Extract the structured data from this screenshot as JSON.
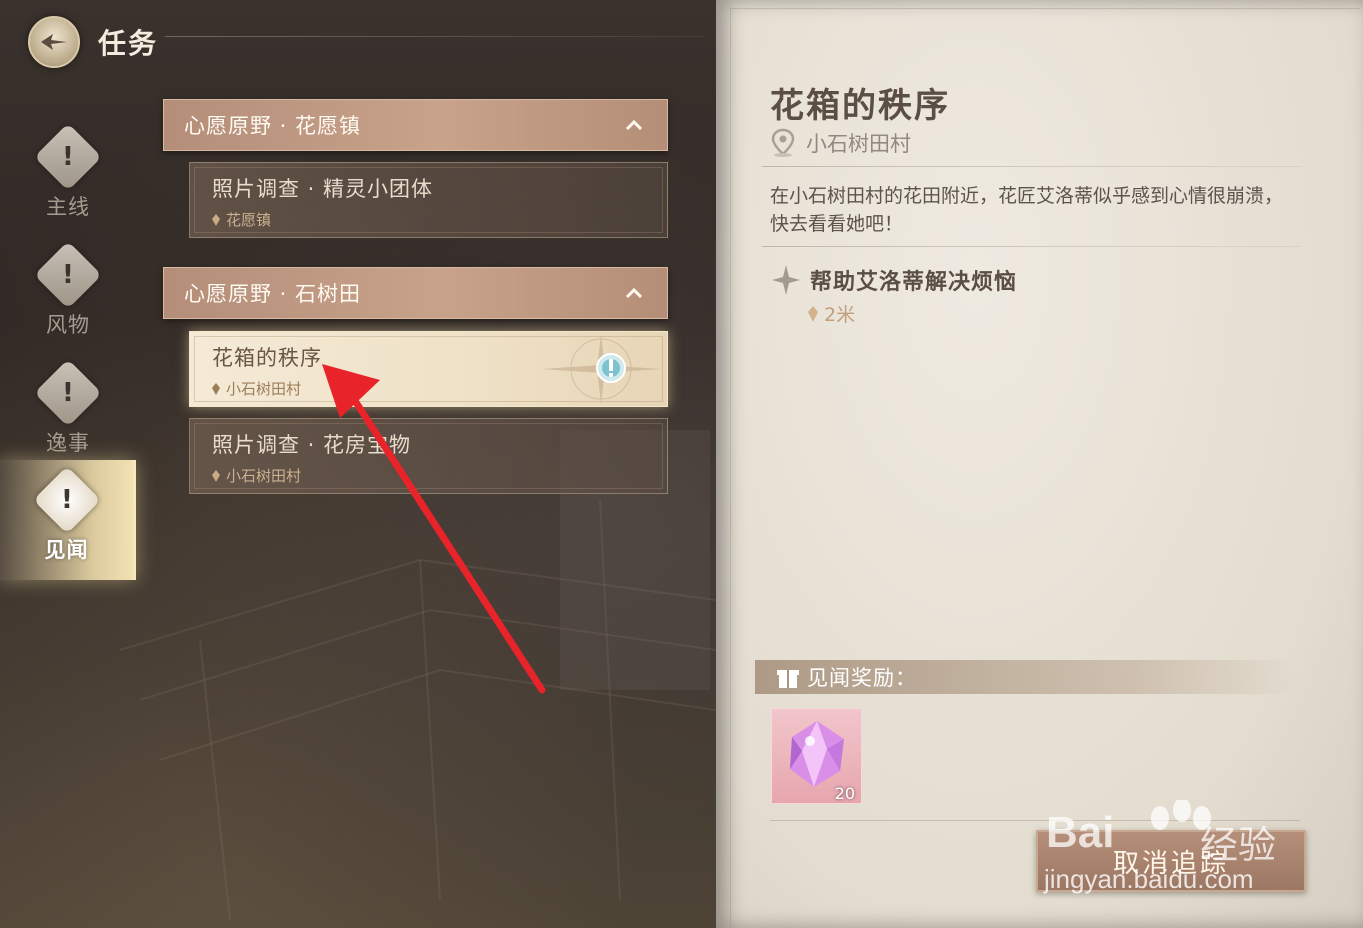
{
  "header": {
    "title": "任务"
  },
  "nav": {
    "items": [
      {
        "label": "主线",
        "icon": "quest-exclaim-icon"
      },
      {
        "label": "风物",
        "icon": "quest-exclaim-icon"
      },
      {
        "label": "逸事",
        "icon": "quest-exclaim-icon"
      },
      {
        "label": "见闻",
        "icon": "quest-exclaim-icon",
        "active": true
      }
    ]
  },
  "groups": [
    {
      "label": "心愿原野 · 花愿镇",
      "quests": [
        {
          "title": "照片调查 · 精灵小团体",
          "location": "花愿镇"
        }
      ]
    },
    {
      "label": "心愿原野 · 石树田",
      "quests": [
        {
          "title": "花箱的秩序",
          "location": "小石树田村",
          "selected": true
        },
        {
          "title": "照片调查 · 花房宝物",
          "location": "小石树田村"
        }
      ]
    }
  ],
  "detail": {
    "title": "花箱的秩序",
    "location": "小石树田村",
    "description": "在小石树田村的花田附近，花匠艾洛蒂似乎感到心情很崩溃，快去看看她吧！",
    "objective": "帮助艾洛蒂解决烦恼",
    "distance": "2米",
    "reward_label": "见闻奖励：",
    "reward": {
      "icon": "crystal-icon",
      "count": "20"
    },
    "cancel_label": "取消追踪"
  },
  "watermark": {
    "line1": "Bai",
    "line2": "经验",
    "line3": "jingyan.baidu.com"
  },
  "colors": {
    "accent": "#c9a28b",
    "selected": "#f4ead6",
    "arrow": "#e8232a"
  }
}
